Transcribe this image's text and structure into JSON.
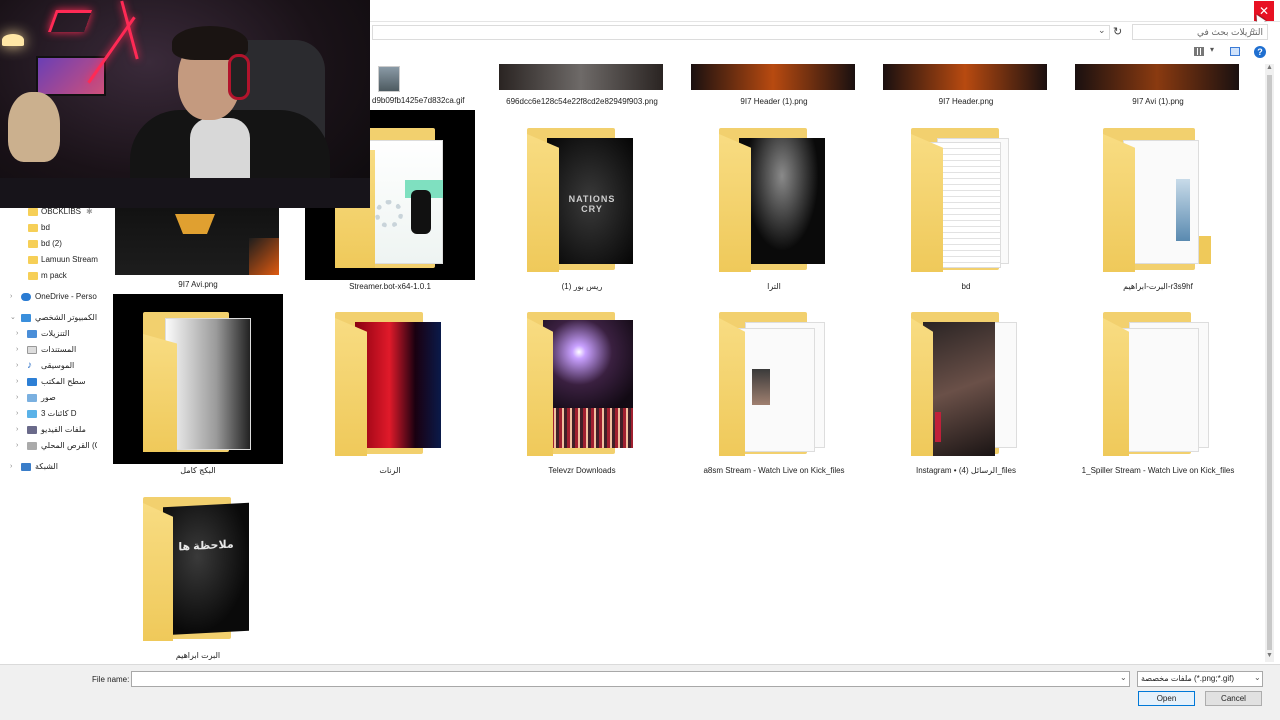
{
  "titlebar": {
    "close_glyph": "✕"
  },
  "address": {
    "search_placeholder": "التنزيلات بحث في"
  },
  "nav": {
    "items": [
      {
        "label": "OBCKLIBS",
        "icon": "folder-icon"
      },
      {
        "label": "bd",
        "icon": "folder-icon"
      },
      {
        "label": "bd (2)",
        "icon": "folder-icon"
      },
      {
        "label": "Lamuun Stream",
        "icon": "folder-icon"
      },
      {
        "label": "m pack",
        "icon": "folder-icon"
      },
      {
        "label": "OneDrive - Perso",
        "icon": "cloud-icon"
      },
      {
        "label": "الكمبيوتر الشخصي",
        "icon": "computer-icon"
      },
      {
        "label": "التنزيلات",
        "icon": "download-icon"
      },
      {
        "label": "المستندات",
        "icon": "documents-icon"
      },
      {
        "label": "الموسيقى",
        "icon": "music-icon"
      },
      {
        "label": "سطح المكتب",
        "icon": "desktop-icon"
      },
      {
        "label": "صور",
        "icon": "pictures-icon"
      },
      {
        "label": "كائنات ثلاثية الأبعاد 3D",
        "display": "3 كائنات D",
        "icon": "3d-objects-icon"
      },
      {
        "label": "ملفات الفيديو",
        "icon": "videos-icon"
      },
      {
        "label": "القرص المحلي (C:)",
        "icon": "drive-icon"
      },
      {
        "label": "الشبكة",
        "icon": "network-icon"
      }
    ]
  },
  "files": {
    "row0": [
      {
        "name": "d9b09fb1425e7d832ca.gif"
      },
      {
        "name": "696dcc6e128c54e22f8cd2e82949f903.png"
      },
      {
        "name": "9I7 Header (1).png"
      },
      {
        "name": "9I7 Header.png"
      },
      {
        "name": "9I7 Avi (1).png"
      }
    ],
    "row1": [
      {
        "name": "9I7 Avi.png"
      },
      {
        "name": "Streamer.bot-x64-1.0.1"
      },
      {
        "name": "ريس بور (1)"
      },
      {
        "name": "الترا"
      },
      {
        "name": "bd"
      },
      {
        "name": "البرت-ابراهيم-r3s9hf"
      }
    ],
    "row2": [
      {
        "name": "البكج كامل"
      },
      {
        "name": "الرنات"
      },
      {
        "name": "Televzr Downloads"
      },
      {
        "name": "a8sm Stream - Watch Live on Kick_files"
      },
      {
        "name": "Instagram • الرسائل (4)_files"
      },
      {
        "name": "1_Spiller Stream - Watch Live on Kick_files"
      }
    ],
    "row3": [
      {
        "name": "البرت ابراهيم"
      }
    ]
  },
  "thumb_text": {
    "nations_cry": "NATIONS CRY",
    "note": "ملاحظة ها"
  },
  "bottom": {
    "file_name_label": "File name:",
    "file_name_value": "",
    "filter_value": "ملفات مخصصة (*.png;*.gif)",
    "open_label": "Open",
    "cancel_label": "Cancel"
  },
  "colors": {
    "close_red": "#e81123",
    "folder_yellow": "#f2d06e",
    "accent_blue": "#0078d7",
    "neon_red": "#ff2a55"
  }
}
